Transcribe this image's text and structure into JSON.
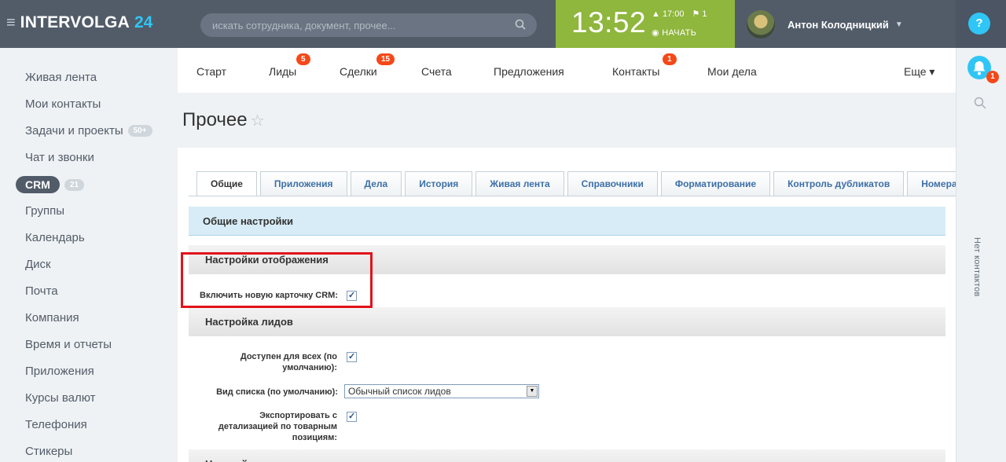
{
  "header": {
    "brand": "INTERVOLGA",
    "brand_num": "24",
    "search_placeholder": "искать сотрудника, документ, прочее...",
    "time": "13:52",
    "alarm": "▲ 17:00",
    "flags": "⚑ 1",
    "start_label": "◉ НАЧАТЬ",
    "user_name": "Антон Колодницкий",
    "help": "?"
  },
  "sidebar": {
    "items": [
      {
        "label": "Живая лента"
      },
      {
        "label": "Мои контакты"
      },
      {
        "label": "Задачи и проекты",
        "counter": "50+"
      },
      {
        "label": "Чат и звонки"
      },
      {
        "label": "CRM",
        "counter": "21"
      },
      {
        "label": "Группы"
      },
      {
        "label": "Календарь"
      },
      {
        "label": "Диск"
      },
      {
        "label": "Почта"
      },
      {
        "label": "Компания"
      },
      {
        "label": "Время и отчеты"
      },
      {
        "label": "Приложения"
      },
      {
        "label": "Курсы валют"
      },
      {
        "label": "Телефония"
      },
      {
        "label": "Стикеры"
      }
    ]
  },
  "rightbar": {
    "bell_count": "1",
    "no_contacts": "Нет контактов"
  },
  "topnav": {
    "items": [
      {
        "label": "Старт"
      },
      {
        "label": "Лиды",
        "badge": "5"
      },
      {
        "label": "Сделки",
        "badge": "15"
      },
      {
        "label": "Счета"
      },
      {
        "label": "Предложения"
      },
      {
        "label": "Контакты",
        "badge": "1"
      },
      {
        "label": "Мои дела"
      },
      {
        "label": "Еще ▾"
      }
    ]
  },
  "page": {
    "title": "Прочее",
    "star": "☆"
  },
  "tabs": [
    "Общие",
    "Приложения",
    "Дела",
    "История",
    "Живая лента",
    "Справочники",
    "Форматирование",
    "Контроль дубликатов",
    "Номера счетов"
  ],
  "settings": {
    "general": "Общие настройки",
    "display": "Настройки отображения",
    "new_card_label": "Включить новую карточку CRM:",
    "leads": "Настройка лидов",
    "available_label": "Доступен для всех (по умолчанию):",
    "list_view_label": "Вид списка (по умолчанию):",
    "list_view_value": "Обычный список лидов",
    "export_label": "Экспортировать с детализацией по товарным позициям:",
    "next_section": "Настройки"
  },
  "colors": {
    "header": "#525c69",
    "accent": "#2fc6f6",
    "timer": "#8fb63d",
    "badge": "#f54819",
    "highlight": "#e3121a"
  }
}
